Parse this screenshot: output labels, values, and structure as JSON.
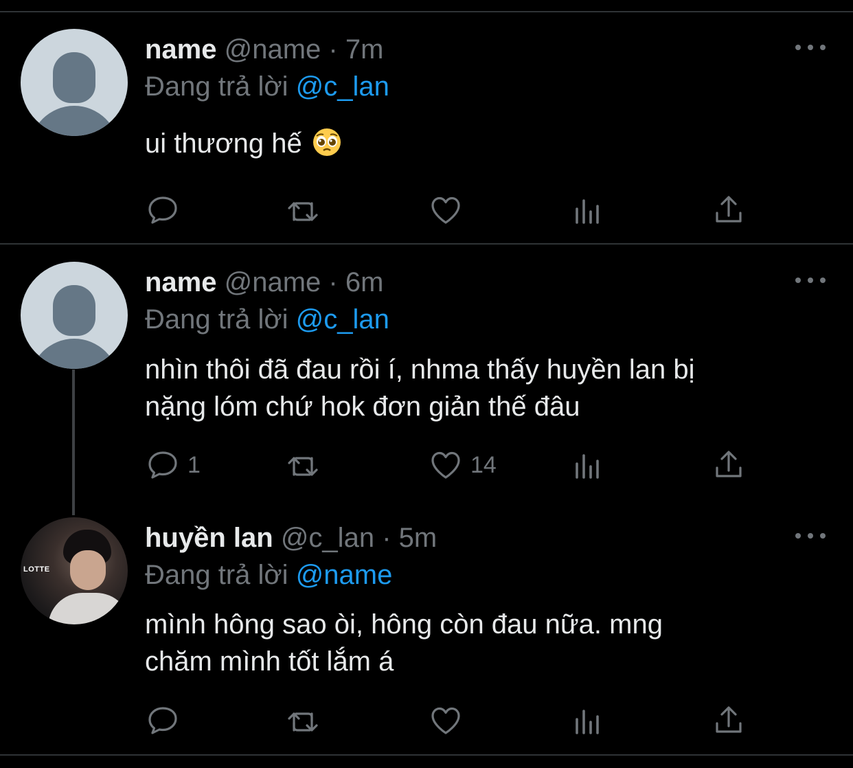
{
  "tweets": [
    {
      "name": "name",
      "handle": "@name",
      "time": "7m",
      "replying_label": "Đang trả lời",
      "replying_to": "@c_lan",
      "text": "ui thương hế",
      "emoji": "pleading-face",
      "replies": "",
      "likes": ""
    },
    {
      "name": "name",
      "handle": "@name",
      "time": "6m",
      "replying_label": "Đang trả lời",
      "replying_to": "@c_lan",
      "text_line1": "nhìn thôi đã đau rồi í, nhma thấy huyền lan bị",
      "text_line2": "nặng lóm chứ hok đơn giản thế đâu",
      "replies": "1",
      "likes": "14"
    },
    {
      "name": "huyền lan",
      "handle": "@c_lan",
      "time": "5m",
      "replying_label": "Đang trả lời",
      "replying_to": "@name",
      "text_line1": "mình hông sao òi, hông còn đau nữa. mng",
      "text_line2": "chăm mình tốt lắm á",
      "avatar_text": "LOTTE",
      "replies": "",
      "likes": ""
    }
  ],
  "separator": "·",
  "colors": {
    "background": "#000000",
    "text": "#e7e9ea",
    "muted": "#71767b",
    "accent": "#1d9bf0",
    "divider": "#2f3336"
  }
}
